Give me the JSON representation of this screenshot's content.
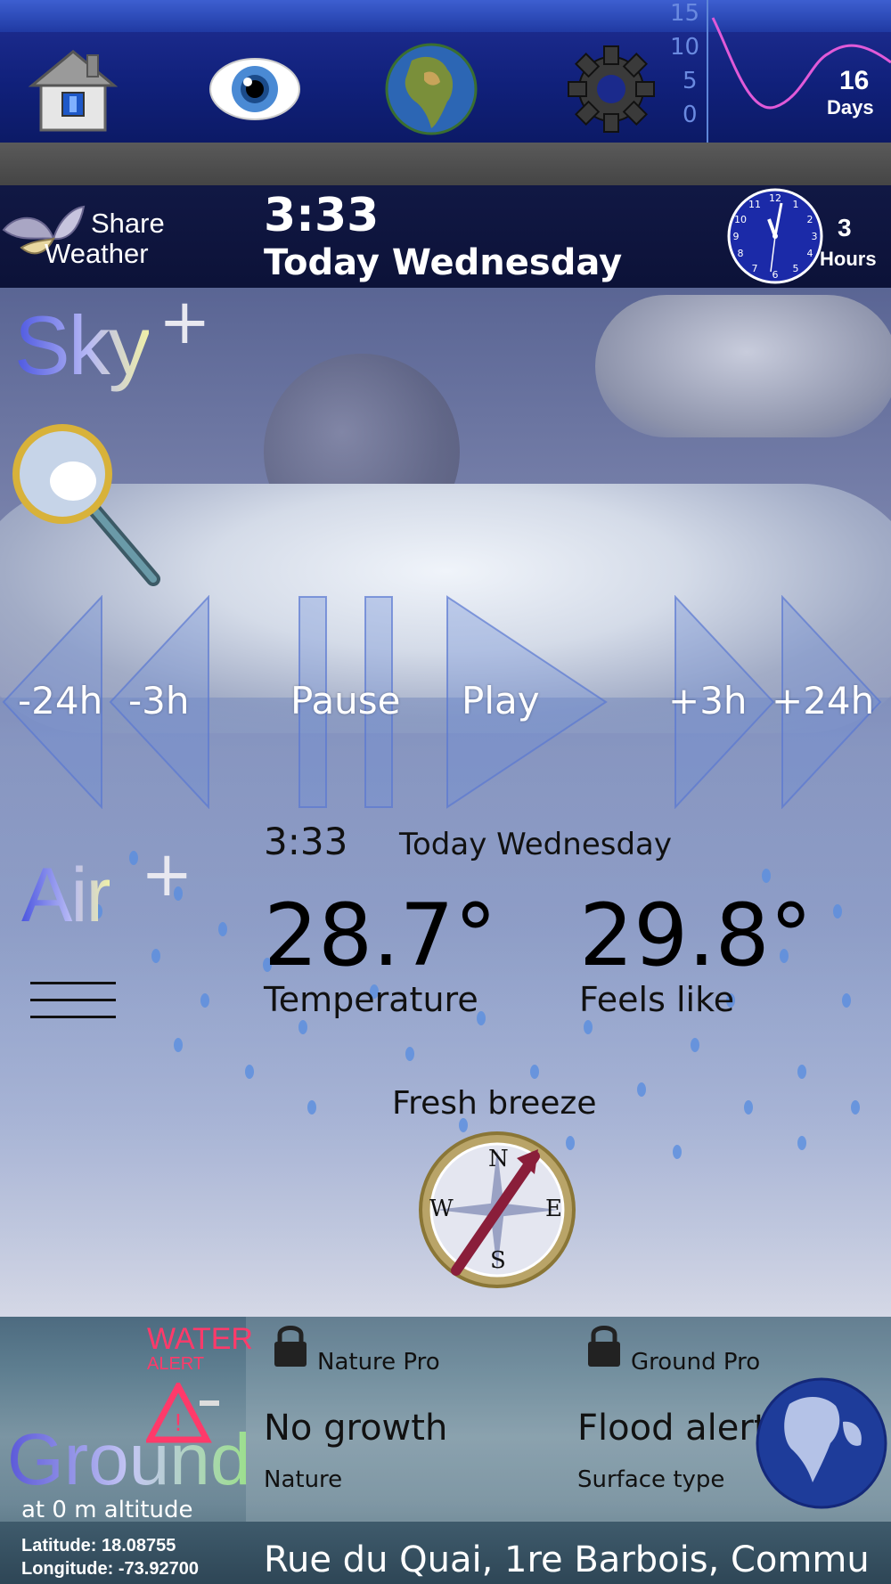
{
  "toolbar": {
    "icons": [
      "home-icon",
      "eye-icon",
      "globe-icon",
      "gear-icon"
    ],
    "days_graph": {
      "axis_ticks": [
        "15",
        "10",
        "5",
        "0"
      ],
      "days_value": "16",
      "days_label": "Days"
    }
  },
  "header": {
    "share_line1": "Share",
    "share_line2": "Weather",
    "time": "3:33",
    "day": "Today Wednesday",
    "hours_value": "3",
    "hours_label": "Hours"
  },
  "sky": {
    "title": "Sky",
    "plus": "+",
    "nav": {
      "back24": "-24h",
      "back3": "-3h",
      "pause": "Pause",
      "play": "Play",
      "fwd3": "+3h",
      "fwd24": "+24h"
    }
  },
  "air": {
    "title": "Air",
    "plus": "+",
    "time": "3:33",
    "day": "Today Wednesday",
    "temperature": "28.7°",
    "temperature_label": "Temperature",
    "feels_like": "29.8°",
    "feels_like_label": "Feels like",
    "wind_label": "Fresh breeze",
    "compass": {
      "n": "N",
      "e": "E",
      "s": "S",
      "w": "W"
    }
  },
  "ground": {
    "title": "Ground",
    "altitude": "at 0 m altitude",
    "latitude": "Latitude: 18.08755",
    "longitude": "Longitude: -73.92700",
    "water_alert_line1": "WATER",
    "water_alert_line2": "ALERT",
    "nature_pro": "Nature Pro",
    "ground_pro": "Ground Pro",
    "nature_value": "No growth",
    "nature_label": "Nature",
    "surface_value": "Flood alert",
    "surface_label": "Surface type",
    "address": "Rue du Quai, 1re Barbois, Commu"
  },
  "colors": {
    "toolbar": "#1b2a8c",
    "timebar": "#111844",
    "water_alert": "#ff3a6a"
  }
}
